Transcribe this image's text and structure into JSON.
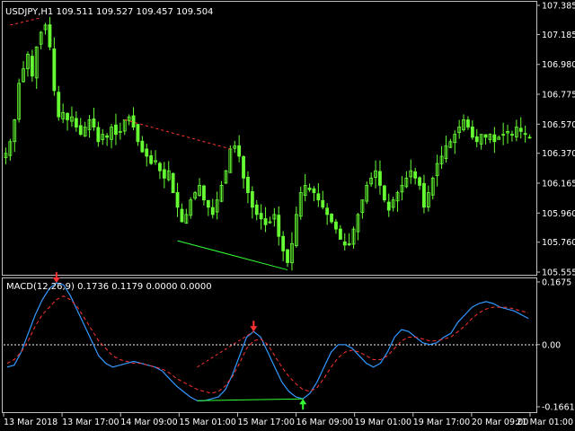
{
  "main_panel": {
    "header": "USDJPY,H1  109.511 109.527 109.457 109.504",
    "price_ticks": [
      "107.385",
      "107.185",
      "106.980",
      "106.775",
      "106.570",
      "106.370",
      "106.165",
      "105.960",
      "105.760",
      "105.555"
    ],
    "colors": {
      "candle": "#66ff33",
      "bearish_divergence": "#ff3333",
      "bullish_divergence": "#33ff33",
      "grid": "#ffffff"
    }
  },
  "macd_panel": {
    "header": "MACD(12,26,9) 0.1736 0.1179 0.0000 0.0000",
    "ticks": [
      "0.1675",
      "0.00",
      "-0.1661"
    ],
    "colors": {
      "macd": "#3399ff",
      "signal": "#ff3333",
      "zero": "#ffffff",
      "arrow_down": "#ff3333",
      "arrow_up": "#33ff33"
    }
  },
  "time_axis": [
    "13 Mar 2018",
    "13 Mar 17:00",
    "14 Mar 09:00",
    "15 Mar 01:00",
    "15 Mar 17:00",
    "16 Mar 09:00",
    "19 Mar 01:00",
    "19 Mar 17:00",
    "20 Mar 09:00",
    "21 Mar 01:00"
  ],
  "chart_data": [
    {
      "type": "candlestick",
      "title": "USDJPY,H1",
      "ylim": [
        105.555,
        107.385
      ],
      "yticks": [
        107.385,
        107.185,
        106.98,
        106.775,
        106.57,
        106.37,
        106.165,
        105.96,
        105.76,
        105.555
      ],
      "close_path": [
        106.37,
        106.45,
        106.6,
        106.85,
        106.95,
        107.05,
        106.9,
        107.1,
        107.2,
        107.25,
        107.1,
        106.8,
        106.62,
        106.65,
        106.6,
        106.62,
        106.55,
        106.5,
        106.55,
        106.6,
        106.55,
        106.45,
        106.5,
        106.48,
        106.55,
        106.5,
        106.52,
        106.6,
        106.62,
        106.55,
        106.45,
        106.38,
        106.35,
        106.3,
        106.32,
        106.25,
        106.2,
        106.25,
        106.1,
        106.0,
        105.9,
        105.95,
        106.05,
        106.1,
        106.15,
        106.05,
        106.0,
        105.95,
        106.05,
        106.15,
        106.25,
        106.4,
        106.42,
        106.35,
        106.2,
        106.1,
        106.0,
        105.95,
        105.92,
        105.88,
        105.9,
        105.95,
        105.8,
        105.7,
        105.62,
        105.75,
        105.95,
        106.1,
        106.15,
        106.12,
        106.1,
        106.05,
        106.0,
        105.95,
        105.9,
        105.85,
        105.78,
        105.74,
        105.75,
        105.85,
        105.95,
        106.05,
        106.15,
        106.2,
        106.25,
        106.15,
        106.05,
        105.98,
        106.05,
        106.1,
        106.15,
        106.2,
        106.25,
        106.2,
        106.15,
        106.0,
        106.1,
        106.2,
        106.3,
        106.35,
        106.42,
        106.45,
        106.5,
        106.55,
        106.6,
        106.55,
        106.48,
        106.45,
        106.5,
        106.48,
        106.5,
        106.45,
        106.48,
        106.5,
        106.52,
        106.5,
        106.55,
        106.52,
        106.5,
        106.48
      ],
      "trendlines": [
        {
          "kind": "bearish",
          "from": [
            1,
            107.25
          ],
          "to": [
            8,
            107.3
          ]
        },
        {
          "kind": "bearish",
          "from": [
            27,
            106.6
          ],
          "to": [
            51,
            106.4
          ]
        },
        {
          "kind": "bullish",
          "from": [
            39,
            105.77
          ],
          "to": [
            64,
            105.57
          ]
        }
      ]
    },
    {
      "type": "line",
      "title": "MACD(12,26,9)",
      "ylim": [
        -0.1661,
        0.1675
      ],
      "yticks": [
        0.1675,
        0.0,
        -0.1661
      ],
      "series": [
        {
          "name": "",
          "color": "#3399ff",
          "values": [
            -0.06,
            -0.055,
            -0.02,
            0.03,
            0.08,
            0.12,
            0.15,
            0.165,
            0.16,
            0.13,
            0.09,
            0.05,
            0.01,
            -0.03,
            -0.05,
            -0.06,
            -0.055,
            -0.05,
            -0.045,
            -0.05,
            -0.055,
            -0.06,
            -0.07,
            -0.09,
            -0.11,
            -0.125,
            -0.14,
            -0.15,
            -0.15,
            -0.145,
            -0.14,
            -0.12,
            -0.08,
            -0.03,
            0.02,
            0.035,
            0.02,
            -0.02,
            -0.06,
            -0.1,
            -0.125,
            -0.14,
            -0.145,
            -0.13,
            -0.1,
            -0.06,
            -0.02,
            0.0,
            0.0,
            -0.01,
            -0.03,
            -0.05,
            -0.06,
            -0.05,
            -0.02,
            0.02,
            0.04,
            0.035,
            0.02,
            0.005,
            0.0,
            0.005,
            0.02,
            0.03,
            0.06,
            0.08,
            0.1,
            0.11,
            0.115,
            0.11,
            0.1,
            0.095,
            0.09,
            0.08,
            0.07
          ]
        },
        {
          "name": "",
          "color": "#ff3333",
          "values": [
            -0.05,
            -0.04,
            -0.02,
            0.01,
            0.05,
            0.08,
            0.1,
            0.12,
            0.13,
            0.12,
            0.1,
            0.07,
            0.04,
            0.01,
            -0.01,
            -0.03,
            -0.04,
            -0.045,
            -0.05,
            -0.05,
            -0.055,
            -0.06,
            -0.065,
            -0.075,
            -0.09,
            -0.1,
            -0.11,
            -0.12,
            -0.125,
            -0.13,
            -0.125,
            -0.11,
            -0.085,
            -0.05,
            -0.01,
            0.01,
            0.015,
            0.0,
            -0.03,
            -0.06,
            -0.085,
            -0.105,
            -0.12,
            -0.125,
            -0.115,
            -0.09,
            -0.06,
            -0.035,
            -0.02,
            -0.015,
            -0.02,
            -0.03,
            -0.04,
            -0.04,
            -0.03,
            -0.01,
            0.01,
            0.02,
            0.02,
            0.015,
            0.01,
            0.01,
            0.015,
            0.02,
            0.035,
            0.05,
            0.07,
            0.085,
            0.095,
            0.1,
            0.1,
            0.1,
            0.095,
            0.09,
            0.085
          ]
        }
      ],
      "signals": [
        {
          "type": "sell",
          "index": 7
        },
        {
          "type": "sell",
          "index": 35
        },
        {
          "type": "buy",
          "index": 42
        }
      ],
      "divergence_lines": [
        {
          "kind": "bearish",
          "from": [
            27,
            -0.06
          ],
          "to": [
            35,
            0.035
          ]
        },
        {
          "kind": "bullish",
          "from": [
            27,
            -0.15
          ],
          "to": [
            42,
            -0.145
          ]
        }
      ]
    }
  ]
}
